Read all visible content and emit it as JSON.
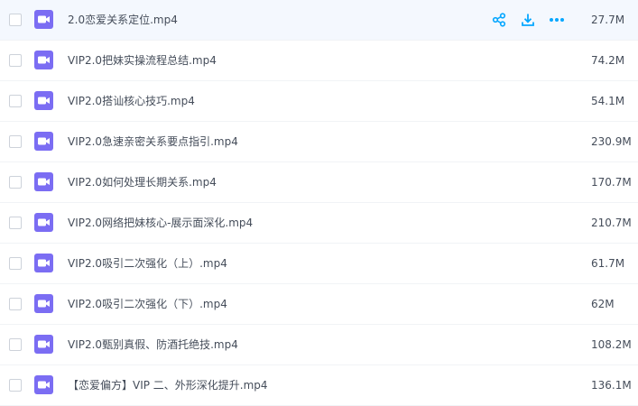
{
  "colors": {
    "accent": "#06a7ff",
    "file_icon": "#7b6df3",
    "row_hover": "#f4f8fe"
  },
  "row_actions": [
    "share-icon",
    "download-icon",
    "more-icon"
  ],
  "files": [
    {
      "name": "2.0恋爱关系定位.mp4",
      "size": "27.7M",
      "icon": "video-file-icon"
    },
    {
      "name": "VIP2.0把妹实操流程总结.mp4",
      "size": "74.2M",
      "icon": "video-file-icon"
    },
    {
      "name": "VIP2.0搭讪核心技巧.mp4",
      "size": "54.1M",
      "icon": "video-file-icon"
    },
    {
      "name": "VIP2.0急速亲密关系要点指引.mp4",
      "size": "230.9M",
      "icon": "video-file-icon"
    },
    {
      "name": "VIP2.0如何处理长期关系.mp4",
      "size": "170.7M",
      "icon": "video-file-icon"
    },
    {
      "name": "VIP2.0网络把妹核心-展示面深化.mp4",
      "size": "210.7M",
      "icon": "video-file-icon"
    },
    {
      "name": "VIP2.0吸引二次强化（上）.mp4",
      "size": "61.7M",
      "icon": "video-file-icon"
    },
    {
      "name": "VIP2.0吸引二次强化（下）.mp4",
      "size": "62M",
      "icon": "video-file-icon"
    },
    {
      "name": "VIP2.0甄别真假、防酒托绝技.mp4",
      "size": "108.2M",
      "icon": "video-file-icon"
    },
    {
      "name": "【恋爱偏方】VIP 二、外形深化提升.mp4",
      "size": "136.1M",
      "icon": "video-file-icon"
    }
  ]
}
